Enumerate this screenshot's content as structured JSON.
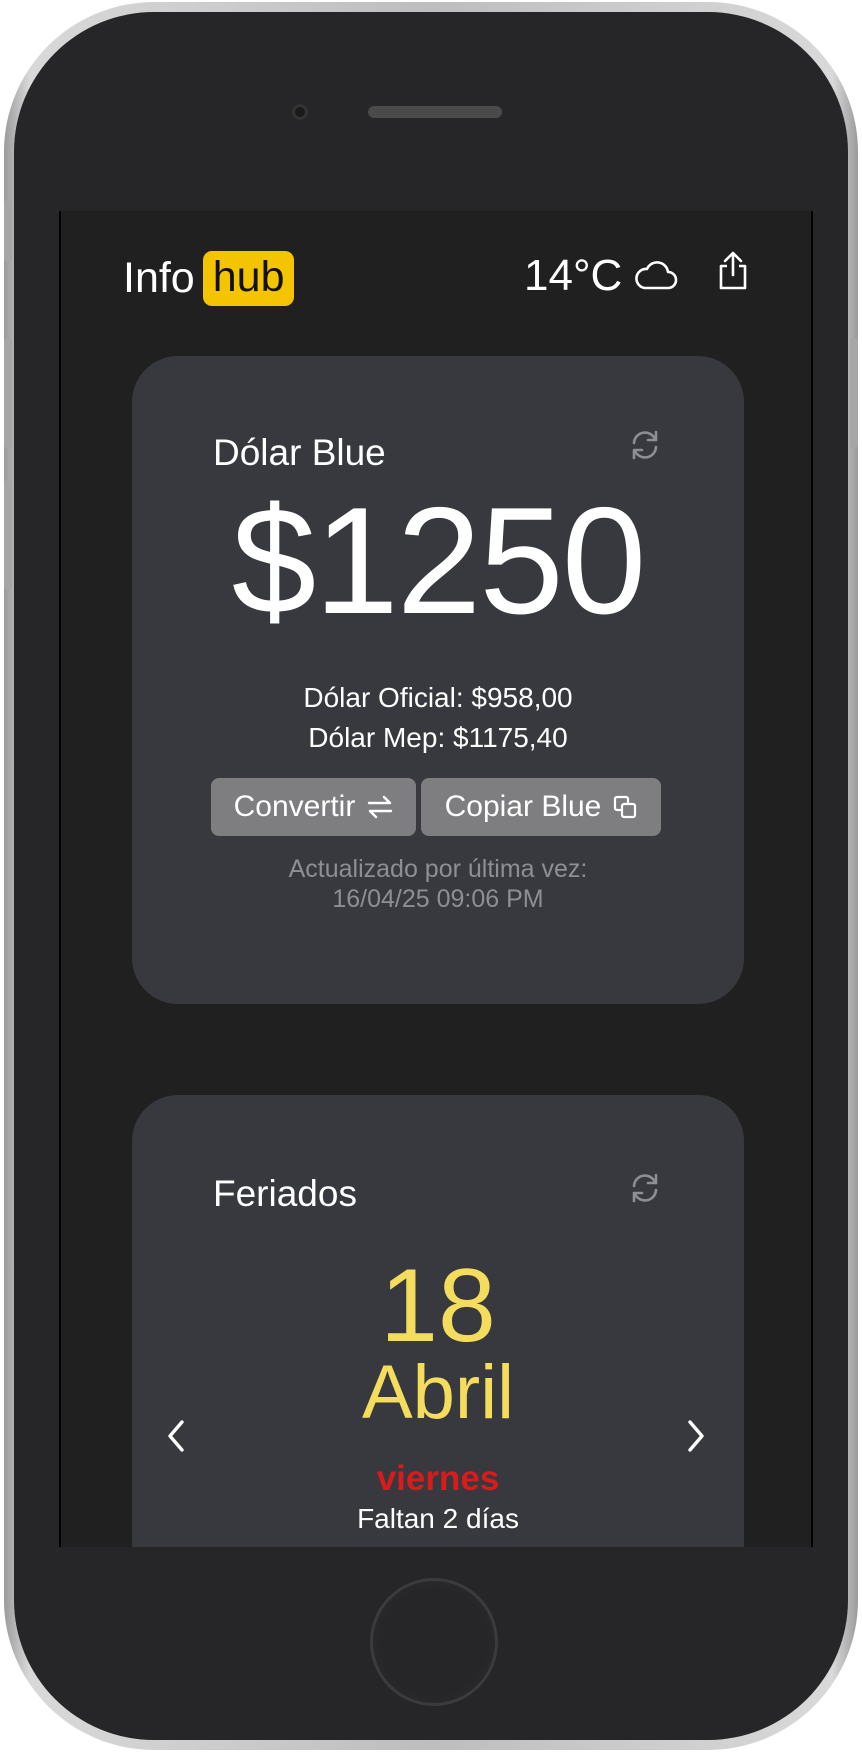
{
  "app": {
    "logo_prefix": "Info",
    "logo_highlight": "hub",
    "temperature": "14°C",
    "weather_icon": "cloud-icon",
    "share_icon": "share-icon"
  },
  "dolar_card": {
    "title": "Dólar Blue",
    "price": "$1250",
    "oficial": "Dólar Oficial: $958,00",
    "mep": "Dólar Mep: $1175,40",
    "convert_label": "Convertir",
    "copy_label": "Copiar Blue",
    "updated_line1": "Actualizado por última vez:",
    "updated_line2": "16/04/25 09:06 PM"
  },
  "feriados_card": {
    "title": "Feriados",
    "day": "18",
    "month": "Abril",
    "weekday": "viernes",
    "countdown": "Faltan 2 días"
  },
  "colors": {
    "accent": "#f5c400",
    "holiday_date": "#f4dd5c",
    "weekday": "#d91b1b",
    "card_bg": "#37393e",
    "screen_bg": "#202020"
  }
}
